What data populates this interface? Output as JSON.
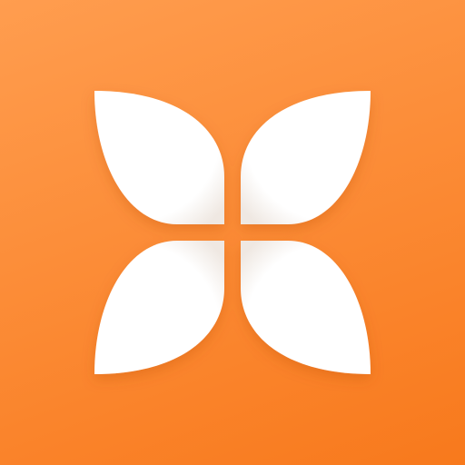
{
  "app_icon": {
    "icon": "four-petal-flower-icon",
    "colors": {
      "background_top": "#ff9d4f",
      "background_bottom": "#f8791c",
      "petal": "#ffffff",
      "petal_shade": "#efe8e2"
    }
  }
}
